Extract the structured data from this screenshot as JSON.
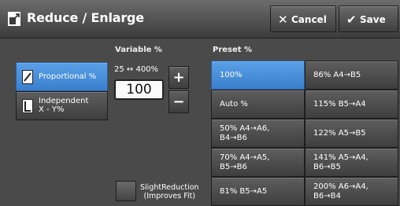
{
  "header": {
    "title": "Reduce / Enlarge",
    "cancel_label": "Cancel",
    "save_label": "Save"
  },
  "variable": {
    "section_label": "Variable %",
    "range_text": "25 ↔ 400%",
    "value": "100",
    "plus_label": "+",
    "minus_label": "−"
  },
  "modes": [
    {
      "label": "Proportional %",
      "selected": true
    },
    {
      "label_line1": "Independent",
      "label_line2": "X - Y%",
      "selected": false
    }
  ],
  "slight_reduction": {
    "line1": "SlightReduction",
    "line2": "(Improves Fit)"
  },
  "preset": {
    "section_label": "Preset %",
    "rows": [
      [
        {
          "text": "100%",
          "selected": true
        },
        {
          "text": "86% A4→B5"
        }
      ],
      [
        {
          "text": "Auto %"
        },
        {
          "text": "115% B5→A4"
        }
      ],
      [
        {
          "text": "50% A4→A6, B4→B6"
        },
        {
          "text": "122% A5→B5"
        }
      ],
      [
        {
          "text": "70% A4→A5, B5→B6"
        },
        {
          "text": "141% A5→A4, B6→B5"
        }
      ],
      [
        {
          "text": "81% B5→A5"
        },
        {
          "text": "200% A6→A4, B6→B4"
        }
      ]
    ]
  },
  "colors": {
    "accent": "#4a90dc",
    "background": "#4a4a4a"
  }
}
